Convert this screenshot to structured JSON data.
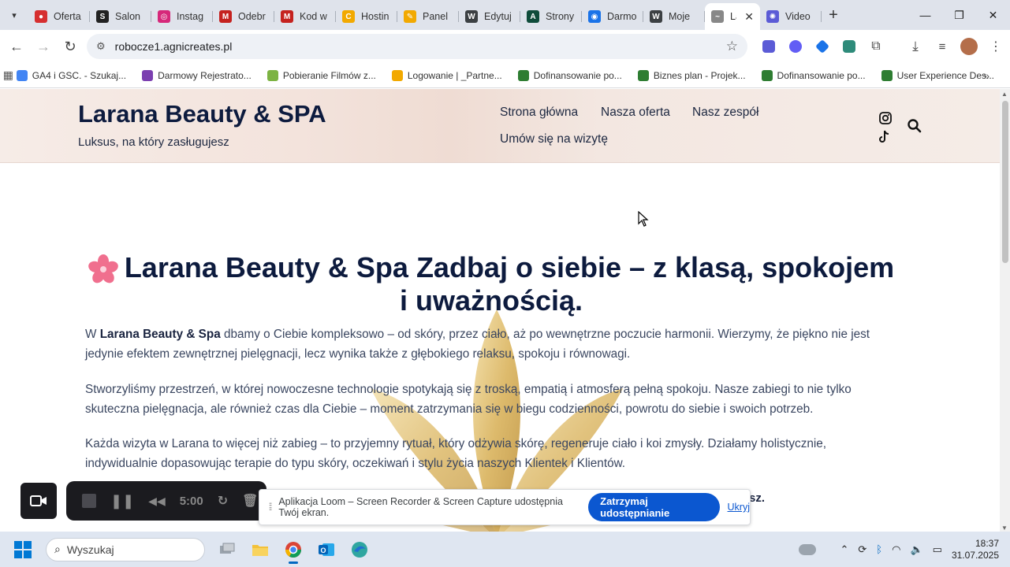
{
  "browser": {
    "tabs": [
      {
        "label": "Oferta",
        "color": "#d62f2f",
        "glyph": "●"
      },
      {
        "label": "Salon",
        "color": "#222222",
        "glyph": "S"
      },
      {
        "label": "Instag",
        "color": "#d6287a",
        "glyph": "◎"
      },
      {
        "label": "Odebr",
        "color": "#c5221f",
        "glyph": "M"
      },
      {
        "label": "Kod w",
        "color": "#c5221f",
        "glyph": "M"
      },
      {
        "label": "Hostin",
        "color": "#f2a900",
        "glyph": "C"
      },
      {
        "label": "Panel",
        "color": "#f2a900",
        "glyph": "✎"
      },
      {
        "label": "Edytuj",
        "color": "#3c4043",
        "glyph": "W"
      },
      {
        "label": "Strony",
        "color": "#0f4c3a",
        "glyph": "A"
      },
      {
        "label": "Darmo",
        "color": "#1a73e8",
        "glyph": "◉"
      },
      {
        "label": "Moje",
        "color": "#3c4043",
        "glyph": "W"
      },
      {
        "label": "La",
        "color": "#888888",
        "glyph": "~"
      },
      {
        "label": "Video",
        "color": "#5b5bd6",
        "glyph": "✺"
      }
    ],
    "active_tab_index": 11,
    "new_tab": "+",
    "url": "robocze1.agnicreates.pl",
    "bookmarks": [
      {
        "label": "GA4 i GSC. - Szukaj...",
        "color": "#4285f4"
      },
      {
        "label": "Darmowy Rejestrato...",
        "color": "#7b3fb0"
      },
      {
        "label": "Pobieranie Filmów z...",
        "color": "#7cb342"
      },
      {
        "label": "Logowanie | _Partne...",
        "color": "#f2a900"
      },
      {
        "label": "Dofinansowanie po...",
        "color": "#2e7d32"
      },
      {
        "label": "Biznes plan - Projek...",
        "color": "#2e7d32"
      },
      {
        "label": "Dofinansowanie po...",
        "color": "#2e7d32"
      },
      {
        "label": "User Experience Des...",
        "color": "#2e7d32"
      }
    ]
  },
  "site": {
    "title": "Larana Beauty & SPA",
    "tagline": "Luksus, na który zasługujesz",
    "nav": [
      "Strona główna",
      "Nasza oferta",
      "Nasz zespół",
      "Umów się na wizytę"
    ],
    "headline": "Larana Beauty & Spa Zadbaj o siebie – z klasą, spokojem i uważnością.",
    "p1_brand": "Larana Beauty & Spa",
    "p1_lead": "W ",
    "p1_rest": " dbamy o Ciebie kompleksowo – od skóry, przez ciało, aż po wewnętrzne poczucie harmonii. Wierzymy, że piękno nie jest jedynie efektem zewnętrznej pielęgnacji, lecz wynika także z głębokiego relaksu, spokoju i równowagi.",
    "p2": "Stworzyliśmy przestrzeń, w której nowoczesne technologie spotykają się z troską, empatią i atmosferą pełną spokoju. Nasze zabiegi to nie tylko skuteczna pielęgnacja, ale również czas dla Ciebie – moment zatrzymania się w biegu codzienności, powrotu do siebie i swoich potrzeb.",
    "p3": "Każda wizyta w Larana to więcej niż zabieg – to przyjemny rytuał, który odżywia skórę, regeneruje ciało i koi zmysły. Działamy holistycznie, indywidualnie dopasowując terapie do typu skóry, oczekiwań i stylu życia naszych Klientek i Klientów.",
    "partial": "sz."
  },
  "loom": {
    "timer": "5:00",
    "share_message": "Aplikacja Loom – Screen Recorder & Screen Capture udostępnia Twój ekran.",
    "stop_label": "Zatrzymaj udostępnianie",
    "hide_label": "Ukryj"
  },
  "taskbar": {
    "search_placeholder": "Wyszukaj",
    "time": "18:37",
    "date": "31.07.2025"
  }
}
